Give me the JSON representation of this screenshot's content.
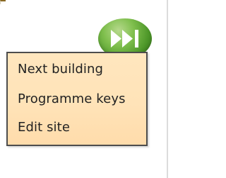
{
  "menu": {
    "items": [
      {
        "label": "Next building"
      },
      {
        "label": "Programme keys"
      },
      {
        "label": "Edit site"
      }
    ]
  },
  "next_button": {
    "icon": "fast-forward-icon",
    "color": "#4c9628"
  },
  "menu_style": {
    "background": "#ffe3b8",
    "border": "#4d4d4d"
  }
}
